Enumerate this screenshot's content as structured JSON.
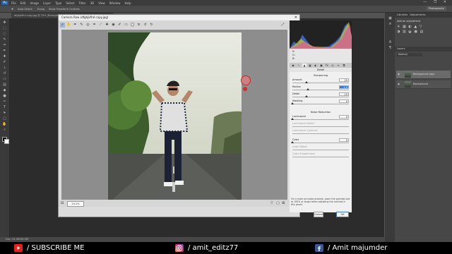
{
  "menubar": {
    "logo": "Ps",
    "items": [
      "File",
      "Edit",
      "Image",
      "Layer",
      "Type",
      "Select",
      "Filter",
      "3D",
      "View",
      "Window",
      "Help"
    ],
    "window_controls": "— ❐ ✕"
  },
  "optionsbar": {
    "auto_select": "Auto-Select:",
    "group": "Group",
    "transform": "Show Transform Controls",
    "workspace": "Photography"
  },
  "doc_tab": "dfghjkfhd copy.jpg @ 25% (Backgrou...",
  "status": "Doc: 25.0M/36.0M",
  "panels": {
    "tabs": [
      "Libraries",
      "Adjustments"
    ],
    "add_adjustment": "Add an adjustment",
    "layers_tab": "Layers",
    "mode": "Normal",
    "layers": [
      "Background copy",
      "Background"
    ]
  },
  "dialog": {
    "title": "Camera Raw (dfghjkfhd copy.jpg)",
    "zoom": "24.2%",
    "rgb": {
      "r": "R:",
      "g": "G:",
      "b": "B:"
    },
    "panel_title": "Detail",
    "sharpening": {
      "header": "Sharpening",
      "rows": [
        {
          "label": "Amount",
          "value": "25"
        },
        {
          "label": "Radius",
          "value": "1.0"
        },
        {
          "label": "Detail",
          "value": "25"
        },
        {
          "label": "Masking",
          "value": "0"
        }
      ]
    },
    "noise": {
      "header": "Noise Reduction",
      "rows": [
        {
          "label": "Luminance",
          "value": "0"
        },
        {
          "label": "Luminance Detail",
          "value": ""
        },
        {
          "label": "Luminance Contrast",
          "value": ""
        },
        {
          "label": "Color",
          "value": "0"
        },
        {
          "label": "Color Detail",
          "value": ""
        },
        {
          "label": "Color Smoothness",
          "value": ""
        }
      ]
    },
    "help": "For a more accurate preview, zoom the preview size to 100% or larger when adjusting the controls in this panel.",
    "cancel": "Cancel",
    "ok": "OK"
  },
  "footer": {
    "youtube": "/ SUBSCRIBE ME",
    "instagram": "/ amit_editz77",
    "facebook": "/ Amit majumder"
  },
  "colors": {
    "accent": "#3a7bd5",
    "youtube": "#e62117",
    "facebook": "#3b5998"
  }
}
